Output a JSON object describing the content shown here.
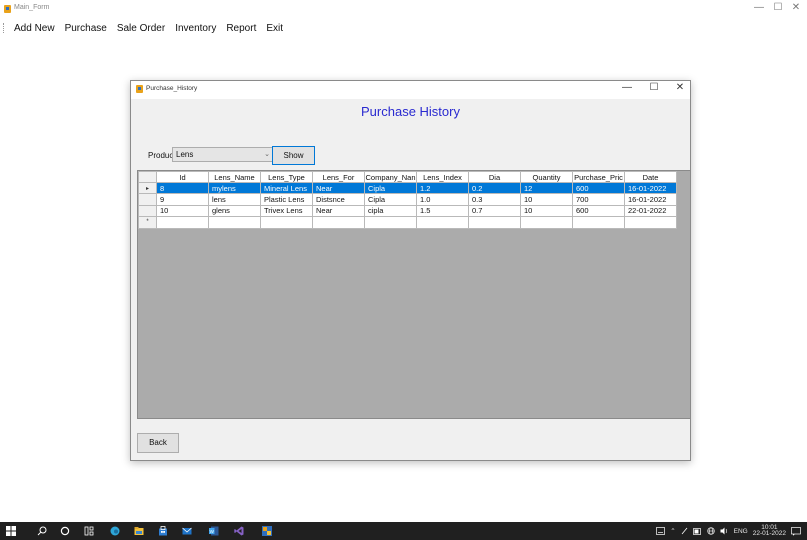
{
  "main_window": {
    "title": "Main_Form",
    "controls": {
      "minimize": "—",
      "maximize": "☐",
      "close": "✕"
    }
  },
  "menu": {
    "items": [
      "Add New",
      "Purchase",
      "Sale Order",
      "Inventory",
      "Report",
      "Exit"
    ]
  },
  "dialog": {
    "title": "Purchase_History",
    "controls": {
      "minimize": "—",
      "maximize": "☐",
      "close": "✕"
    },
    "heading": "Purchase History",
    "product_label": "Product",
    "product_value": "Lens",
    "show_label": "Show",
    "back_label": "Back",
    "heading_color": "#2a2ad0",
    "selection_color": "#0078d7"
  },
  "grid": {
    "columns": [
      "Id",
      "Lens_Name",
      "Lens_Type",
      "Lens_For",
      "Company_Nan",
      "Lens_Index",
      "Dia",
      "Quantity",
      "Purchase_Pric",
      "Date"
    ],
    "rows": [
      {
        "marker": "▸",
        "selected": true,
        "cells": [
          "8",
          "mylens",
          "Mineral Lens",
          "Near",
          "Cipla",
          "1.2",
          "0.2",
          "12",
          "600",
          "16-01-2022"
        ]
      },
      {
        "marker": "",
        "selected": false,
        "cells": [
          "9",
          "lens",
          "Plastic Lens",
          "Distsnce",
          "Cipla",
          "1.0",
          "0.3",
          "10",
          "700",
          "16-01-2022"
        ]
      },
      {
        "marker": "",
        "selected": false,
        "cells": [
          "10",
          "glens",
          "Trivex Lens",
          "Near",
          "cipla",
          "1.5",
          "0.7",
          "10",
          "600",
          "22-01-2022"
        ]
      },
      {
        "marker": "*",
        "selected": false,
        "cells": [
          "",
          "",
          "",
          "",
          "",
          "",
          "",
          "",
          "",
          ""
        ]
      }
    ]
  },
  "taskbar": {
    "icons": [
      "windows-icon",
      "search-icon",
      "cortana-icon",
      "task-view-icon",
      "edge-icon",
      "file-explorer-icon",
      "store-icon",
      "mail-icon",
      "word-icon",
      "visual-studio-icon",
      "app-icon"
    ],
    "tray": {
      "language": "ENG",
      "time": "10:01",
      "date": "22-01-2022"
    }
  }
}
